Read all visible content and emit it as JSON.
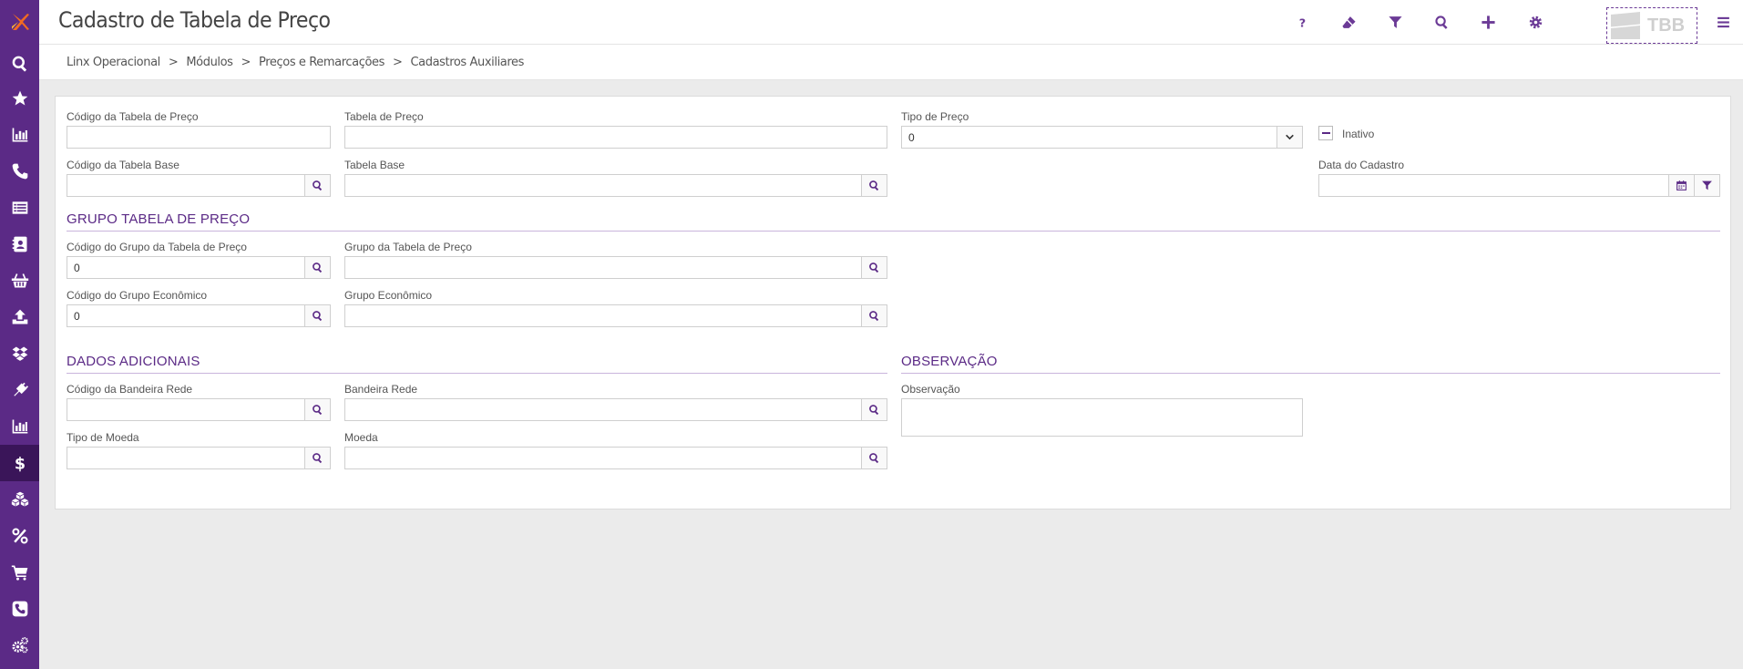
{
  "app": {
    "title": "Cadastro de Tabela de Preço",
    "tbb_text": "TBB"
  },
  "sidebar": {
    "items": [
      {
        "icon": "search-icon"
      },
      {
        "icon": "star-icon"
      },
      {
        "icon": "bar-chart-icon"
      },
      {
        "icon": "phone-icon"
      },
      {
        "icon": "list-icon"
      },
      {
        "icon": "contact-card-icon"
      },
      {
        "icon": "basket-icon"
      },
      {
        "icon": "upload-icon"
      },
      {
        "icon": "dropbox-icon"
      },
      {
        "icon": "plug-icon"
      },
      {
        "icon": "bar-chart-icon"
      },
      {
        "icon": "dollar-icon",
        "active": true
      },
      {
        "icon": "cubes-icon"
      },
      {
        "icon": "percent-icon"
      },
      {
        "icon": "cart-icon"
      },
      {
        "icon": "phone-square-icon"
      },
      {
        "icon": "cogs-icon"
      }
    ]
  },
  "header_icons": [
    "help-icon",
    "eraser-icon",
    "filter-icon",
    "search-icon",
    "add-icon",
    "gear-icon",
    "menu-icon"
  ],
  "breadcrumb": [
    "Linx Operacional",
    "Módulos",
    "Preços e Remarcações",
    "Cadastros Auxiliares"
  ],
  "breadcrumb_sep": ">",
  "form": {
    "codigo_tabela_label": "Código da Tabela de Preço",
    "codigo_tabela_value": "",
    "tabela_preco_label": "Tabela de Preço",
    "tabela_preco_value": "",
    "tipo_preco_label": "Tipo de Preço",
    "tipo_preco_value": "0",
    "inativo_label": "Inativo",
    "codigo_tabela_base_label": "Código da Tabela Base",
    "tabela_base_label": "Tabela Base",
    "data_cadastro_label": "Data do Cadastro",
    "data_cadastro_value": ""
  },
  "grupo": {
    "title": "GRUPO TABELA DE PREÇO",
    "codigo_grupo_label": "Código do Grupo da Tabela de Preço",
    "codigo_grupo_value": "0",
    "grupo_tabela_label": "Grupo da Tabela de Preço",
    "codigo_grupo_economico_label": "Código do Grupo Econômico",
    "codigo_grupo_economico_value": "0",
    "grupo_economico_label": "Grupo Econômico"
  },
  "dados": {
    "title": "DADOS ADICIONAIS",
    "codigo_bandeira_label": "Código da Bandeira Rede",
    "bandeira_label": "Bandeira Rede",
    "tipo_moeda_label": "Tipo de Moeda",
    "moeda_label": "Moeda"
  },
  "observacao": {
    "title": "OBSERVAÇÃO",
    "label": "Observação",
    "value": ""
  },
  "colors": {
    "sidebar": "#5b2a86",
    "sidebar_active": "#3a1559",
    "accent": "#6b3a96"
  }
}
